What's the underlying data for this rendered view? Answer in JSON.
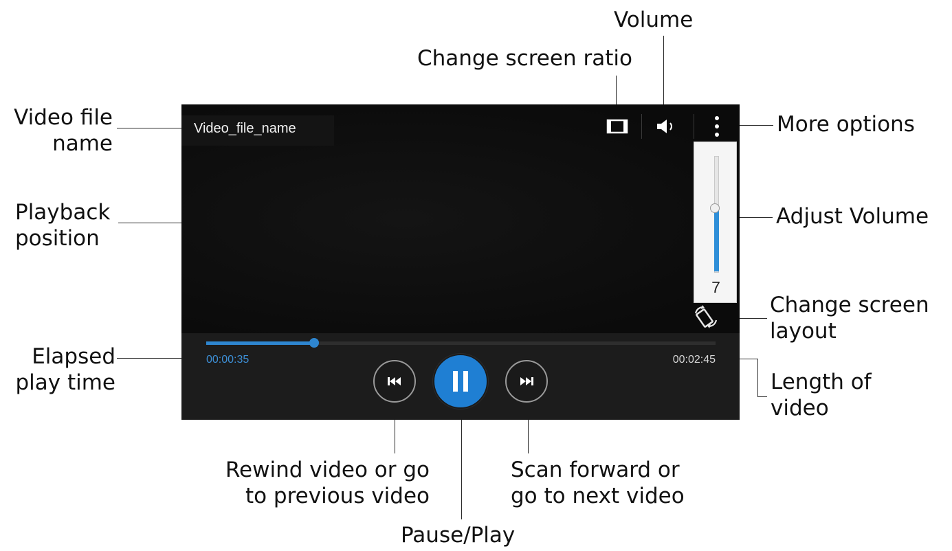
{
  "player": {
    "file_name": "Video_file_name",
    "elapsed": "00:00:35",
    "total": "00:02:45",
    "playback_fraction": 0.212,
    "volume_level": "7",
    "volume_fraction": 0.55,
    "is_playing": true
  },
  "callouts": {
    "volume": "Volume",
    "change_ratio": "Change screen ratio",
    "video_file_name": "Video file\nname",
    "more_options": "More options",
    "playback_position": "Playback\nposition",
    "adjust_volume": "Adjust Volume",
    "change_layout": "Change screen\nlayout",
    "elapsed_time": "Elapsed\nplay time",
    "length_of_video": "Length of\nvideo",
    "rewind": "Rewind video or go\nto previous video",
    "forward": "Scan forward or\ngo to next video",
    "pause_play": "Pause/Play"
  },
  "icons": {
    "ratio": "screen-ratio-icon",
    "volume": "speaker-icon",
    "more": "vertical-dots-icon",
    "rotate": "rotate-screen-icon",
    "rewind": "skip-previous-icon",
    "pause": "pause-icon",
    "forward": "skip-next-icon"
  },
  "colors": {
    "accent": "#2e86d0",
    "player_bg": "#0c0c0c",
    "controls_bg": "#1c1c1c"
  }
}
